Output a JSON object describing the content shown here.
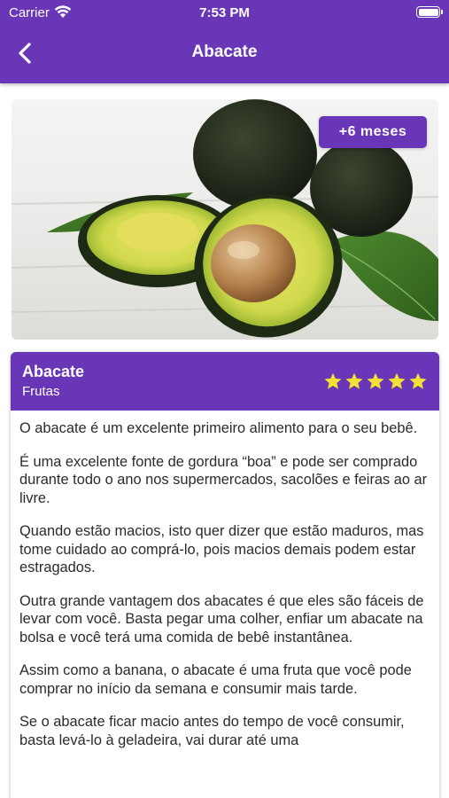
{
  "status_bar": {
    "carrier": "Carrier",
    "time": "7:53 PM",
    "wifi_icon": "wifi-icon",
    "battery_icon": "battery-icon"
  },
  "header": {
    "title": "Abacate",
    "back_icon": "chevron-left-icon",
    "background_color": "#6a36b8"
  },
  "hero": {
    "image": "avocado-photo",
    "age_badge": "+6 meses"
  },
  "card": {
    "title": "Abacate",
    "category": "Frutas",
    "rating": {
      "value": 5,
      "max": 5,
      "star_color": "#f5e133"
    },
    "paragraphs": [
      "O abacate é um excelente primeiro alimento para o seu bebê.",
      "É uma excelente fonte de gordura “boa” e pode ser comprado durante todo o ano nos supermercados, sacolões e feiras ao ar livre.",
      "Quando estão macios, isto quer dizer que estão maduros, mas tome cuidado ao comprá-lo, pois macios demais podem estar estragados.",
      "Outra grande vantagem dos abacates é que eles são fáceis de levar com você. Basta pegar uma colher, enfiar um abacate na bolsa e você terá uma comida de bebê instantânea.",
      "Assim como a banana, o abacate é uma fruta que você pode comprar no início da semana e consumir mais tarde.",
      "Se o abacate ficar macio antes do tempo de você consumir, basta levá-lo à geladeira, vai durar até uma"
    ]
  }
}
